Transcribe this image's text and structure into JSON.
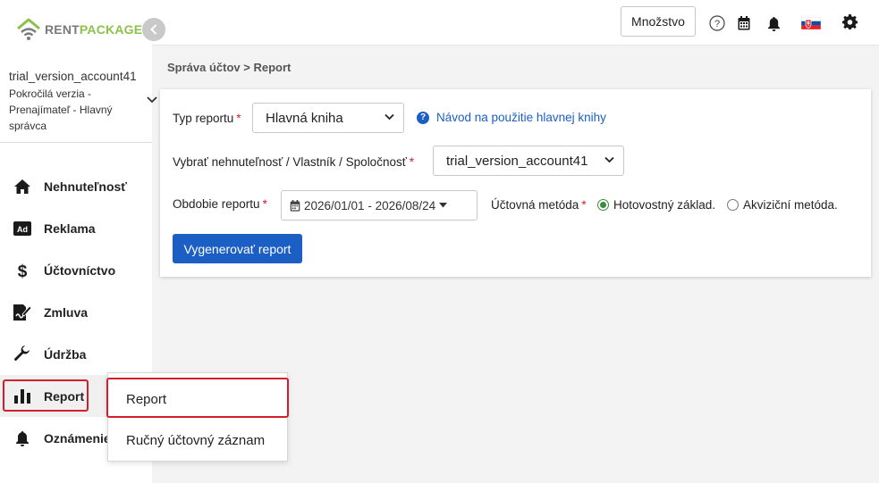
{
  "app": {
    "logo_rent": "RENT",
    "logo_package": "PACKAGE"
  },
  "account": {
    "name": "trial_version_account41",
    "role": "Pokročilá verzia - Prenajímateľ - Hlavný správca"
  },
  "nav": {
    "items": [
      {
        "label": "Nehnuteľnosť",
        "icon": "home-icon"
      },
      {
        "label": "Reklama",
        "icon": "ad-icon"
      },
      {
        "label": "Účtovníctvo",
        "icon": "dollar-icon"
      },
      {
        "label": "Zmluva",
        "icon": "contract-icon"
      },
      {
        "label": "Údržba",
        "icon": "wrench-icon"
      },
      {
        "label": "Report",
        "icon": "bar-chart-icon"
      },
      {
        "label": "Oznámenie",
        "icon": "bell-icon"
      }
    ]
  },
  "submenu": {
    "items": [
      "Report",
      "Ručný účtovný záznam"
    ]
  },
  "topbar": {
    "quantity_label": "Množstvo",
    "icons": [
      "help-icon",
      "calendar-icon",
      "bell-icon",
      "slovak-flag-icon",
      "gear-icon"
    ]
  },
  "breadcrumb": "Správa účtov > Report",
  "form": {
    "report_type_label": "Typ reportu",
    "report_type_value": "Hlavná kniha",
    "help_link": "Návod na použitie hlavnej knihy",
    "property_label": "Vybrať nehnuteľnosť / Vlastník / Spoločnosť",
    "property_value": "trial_version_account41",
    "period_label": "Obdobie reportu",
    "period_value": "2026/01/01 - 2026/08/24",
    "method_label": "Účtovná metóda",
    "method_options": [
      "Hotovostný základ.",
      "Akviziční metóda."
    ],
    "method_selected": "Hotovostný základ.",
    "required_mark": "*",
    "generate_button": "Vygenerovať report"
  },
  "colors": {
    "primary": "#1b5fc4",
    "brand_green": "#8bc34a",
    "highlight_red": "#d21f2a"
  }
}
